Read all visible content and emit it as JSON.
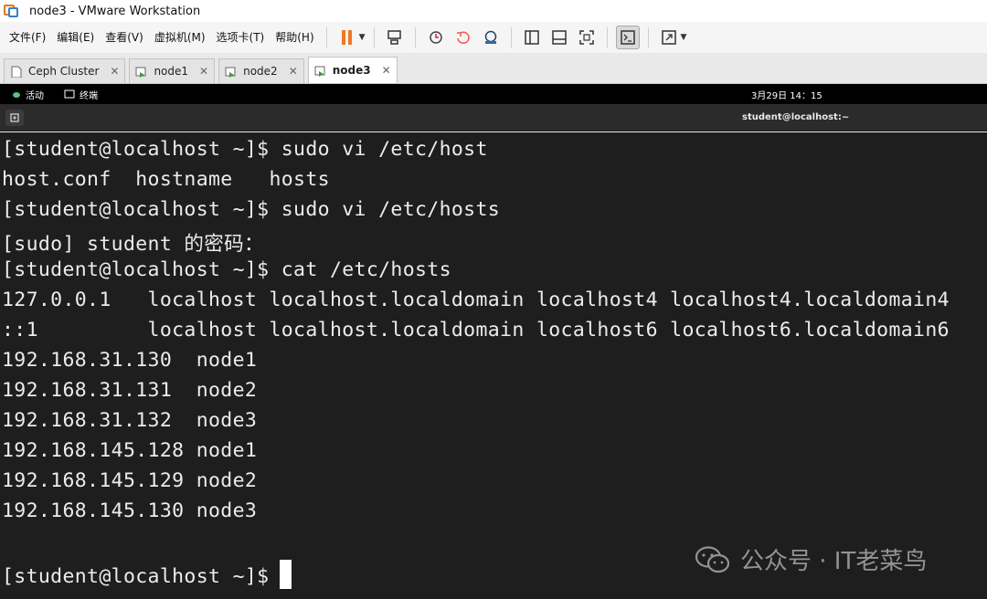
{
  "window": {
    "title": "node3 - VMware Workstation"
  },
  "menu": [
    "文件(F)",
    "编辑(E)",
    "查看(V)",
    "虚拟机(M)",
    "选项卡(T)",
    "帮助(H)"
  ],
  "tabs": [
    {
      "label": "Ceph Cluster",
      "active": false
    },
    {
      "label": "node1",
      "active": false
    },
    {
      "label": "node2",
      "active": false
    },
    {
      "label": "node3",
      "active": true
    }
  ],
  "gnome": {
    "activities": "活动",
    "app": "终端",
    "clock": "3月29日  14：15"
  },
  "terminal": {
    "title": "student@localhost:~",
    "lines": [
      "[student@localhost ~]$ sudo vi /etc/host",
      "host.conf  hostname   hosts",
      "[student@localhost ~]$ sudo vi /etc/hosts",
      "[sudo] student 的密码：",
      "[student@localhost ~]$ cat /etc/hosts",
      "127.0.0.1   localhost localhost.localdomain localhost4 localhost4.localdomain4",
      "::1         localhost localhost.localdomain localhost6 localhost6.localdomain6",
      "192.168.31.130  node1",
      "192.168.31.131  node2",
      "192.168.31.132  node3",
      "192.168.145.128 node1",
      "192.168.145.129 node2",
      "192.168.145.130 node3",
      "",
      "[student@localhost ~]$"
    ]
  },
  "watermark": {
    "text": "公众号 · IT老菜鸟"
  }
}
